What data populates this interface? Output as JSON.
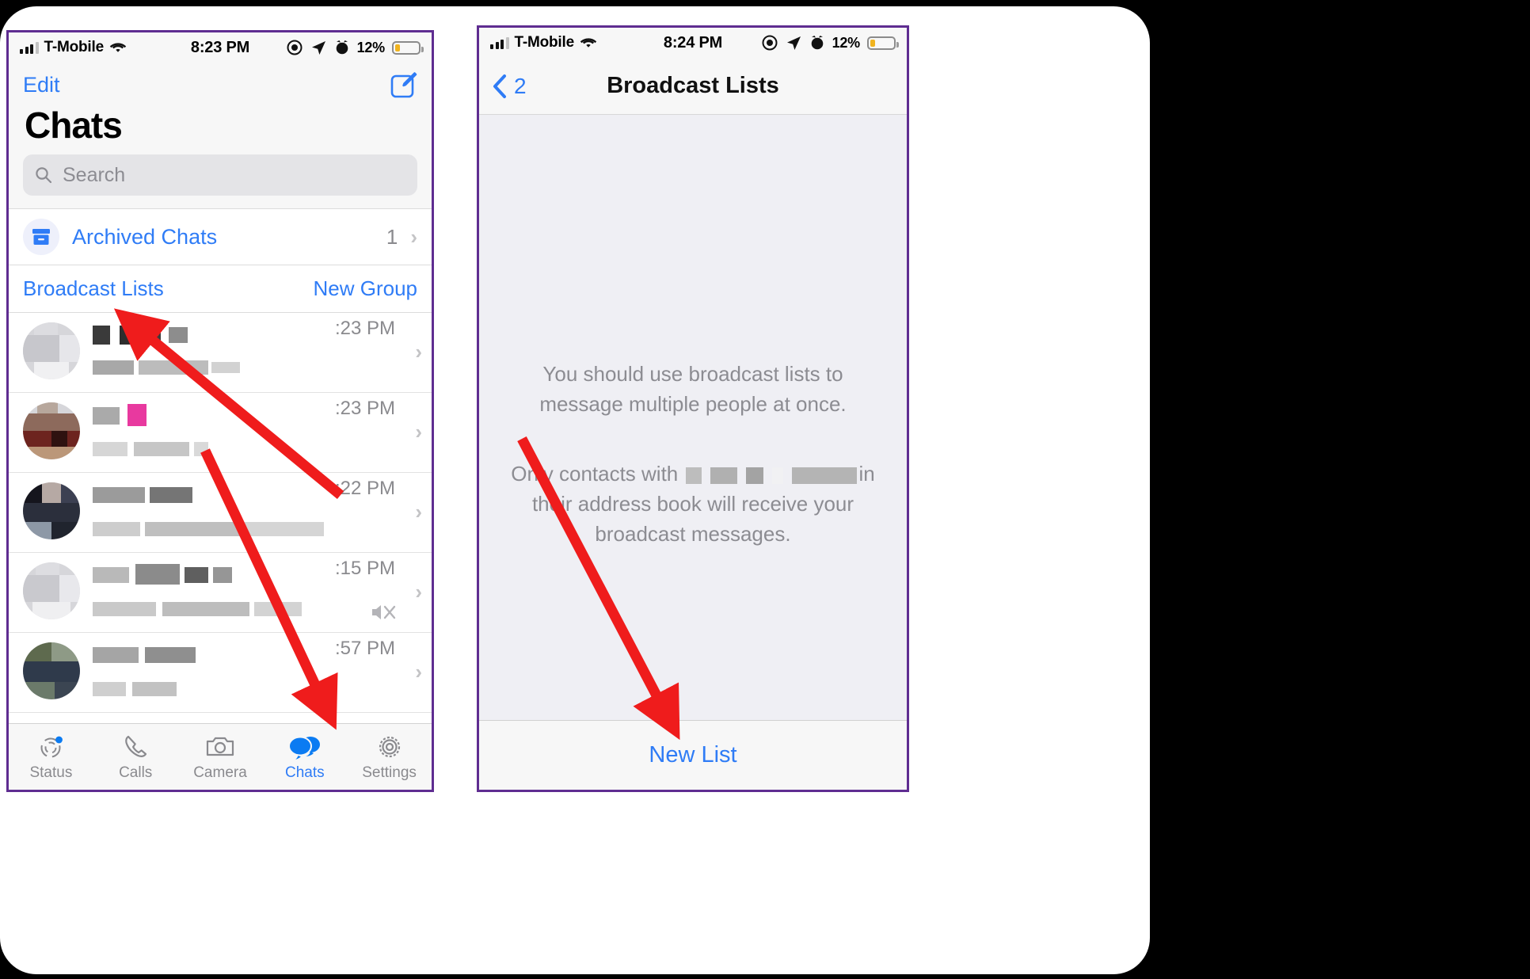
{
  "left_phone": {
    "status_bar": {
      "carrier": "T-Mobile",
      "time": "8:23 PM",
      "battery_pct": "12%",
      "icons": [
        "signal-bars-icon",
        "wifi-icon",
        "screen-record-icon",
        "location-arrow-icon",
        "alarm-icon",
        "battery-icon"
      ]
    },
    "nav": {
      "edit_label": "Edit",
      "compose_icon": "compose-icon"
    },
    "title": "Chats",
    "search": {
      "placeholder": "Search",
      "icon": "search-icon"
    },
    "archived": {
      "label": "Archived Chats",
      "count": "1",
      "icon": "archive-box-icon",
      "chevron": "›"
    },
    "actions": {
      "broadcast_lists": "Broadcast Lists",
      "new_group": "New Group"
    },
    "chat_rows": [
      {
        "time": ":23 PM",
        "name": "[redacted]",
        "preview": "[redacted]",
        "muted": false
      },
      {
        "time": ":23 PM",
        "name": "[redacted]",
        "preview": "[redacted]",
        "muted": false
      },
      {
        "time": ":22 PM",
        "name": "[redacted]",
        "preview": "[redacted]",
        "muted": false
      },
      {
        "time": ":15 PM",
        "name": "[redacted]",
        "preview": "w...",
        "muted": true
      },
      {
        "time": ":57 PM",
        "name": "[redacted]",
        "preview": "[redacted]",
        "muted": false
      }
    ],
    "tabs": [
      {
        "label": "Status",
        "icon": "status-ring-icon",
        "active": false
      },
      {
        "label": "Calls",
        "icon": "phone-icon",
        "active": false
      },
      {
        "label": "Camera",
        "icon": "camera-icon",
        "active": false
      },
      {
        "label": "Chats",
        "icon": "chat-bubbles-icon",
        "active": true
      },
      {
        "label": "Settings",
        "icon": "gear-icon",
        "active": false
      }
    ]
  },
  "right_phone": {
    "status_bar": {
      "carrier": "T-Mobile",
      "time": "8:24 PM",
      "battery_pct": "12%"
    },
    "nav": {
      "back_label": "2",
      "back_icon": "chevron-left-icon",
      "title": "Broadcast Lists"
    },
    "empty_state": {
      "paragraph_1": "You should use broadcast lists to message multiple people at once.",
      "paragraph_2_prefix": "Only contacts with",
      "paragraph_2_suffix": "in their address book will receive your broadcast messages."
    },
    "new_list_button": "New List"
  },
  "annotations": {
    "arrows": [
      {
        "name": "arrow-to-broadcast-lists",
        "color": "#ef1c1c"
      },
      {
        "name": "arrow-to-chats-tab",
        "color": "#ef1c1c"
      },
      {
        "name": "arrow-to-new-list",
        "color": "#ef1c1c"
      }
    ]
  },
  "colors": {
    "ios_blue": "#2f7cf6",
    "arrow_red": "#ef1c1c",
    "phone_border": "#5f2d91",
    "background": "#000000",
    "battery_yellow": "#f0b31e"
  }
}
